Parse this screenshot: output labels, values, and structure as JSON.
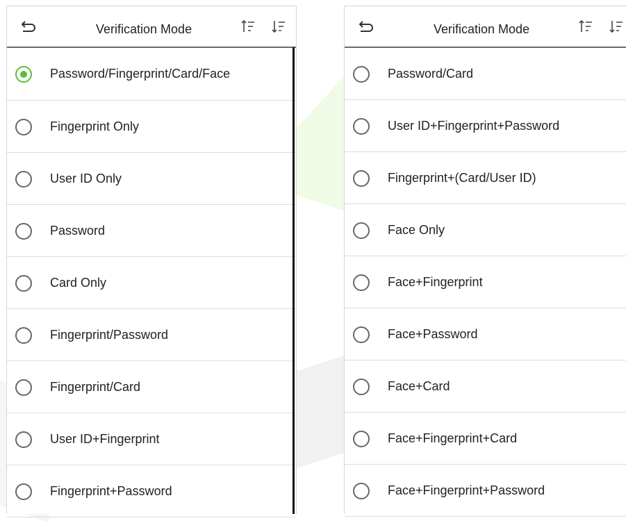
{
  "left_panel": {
    "title": "Verification Mode",
    "back_icon": "back-arrow-icon",
    "sort_asc_icon": "sort-ascending-icon",
    "sort_desc_icon": "sort-descending-icon",
    "items": [
      {
        "label": "Password/Fingerprint/Card/Face",
        "checked": true
      },
      {
        "label": "Fingerprint Only",
        "checked": false
      },
      {
        "label": "User ID Only",
        "checked": false
      },
      {
        "label": "Password",
        "checked": false
      },
      {
        "label": "Card Only",
        "checked": false
      },
      {
        "label": "Fingerprint/Password",
        "checked": false
      },
      {
        "label": "Fingerprint/Card",
        "checked": false
      },
      {
        "label": "User ID+Fingerprint",
        "checked": false
      },
      {
        "label": "Fingerprint+Password",
        "checked": false
      }
    ]
  },
  "right_panel": {
    "title": "Verification Mode",
    "back_icon": "back-arrow-icon",
    "sort_asc_icon": "sort-ascending-icon",
    "sort_desc_icon": "sort-descending-icon",
    "items": [
      {
        "label": "Password/Card",
        "checked": false
      },
      {
        "label": "User ID+Fingerprint+Password",
        "checked": false
      },
      {
        "label": "Fingerprint+(Card/User ID)",
        "checked": false
      },
      {
        "label": "Face Only",
        "checked": false
      },
      {
        "label": "Face+Fingerprint",
        "checked": false
      },
      {
        "label": "Face+Password",
        "checked": false
      },
      {
        "label": "Face+Card",
        "checked": false
      },
      {
        "label": "Face+Fingerprint+Card",
        "checked": false
      },
      {
        "label": "Face+Fingerprint+Password",
        "checked": false
      }
    ]
  },
  "colors": {
    "selected_radio": "#5bbf35",
    "unselected_radio": "#666666",
    "divider": "#dcdcdc",
    "header_rule": "#6a6a6a"
  }
}
